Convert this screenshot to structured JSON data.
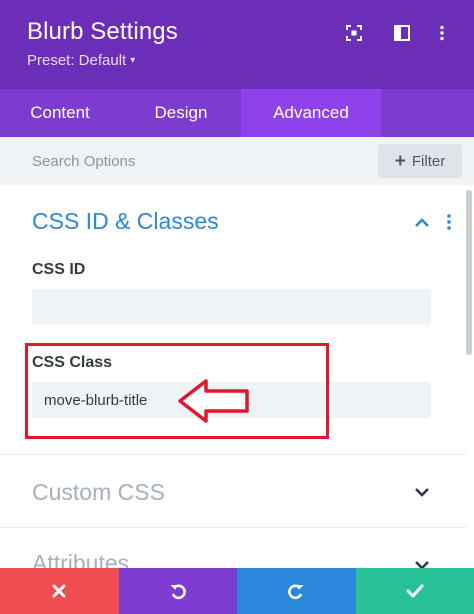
{
  "header": {
    "title": "Blurb Settings",
    "preset": "Preset: Default",
    "icons": [
      "fullscreen-icon",
      "split-view-icon",
      "more-options-icon"
    ],
    "background": "#6c2eb9"
  },
  "tabs": [
    {
      "label": "Content",
      "active": false
    },
    {
      "label": "Design",
      "active": false
    },
    {
      "label": "Advanced",
      "active": true
    }
  ],
  "search": {
    "placeholder": "Search Options",
    "filter_label": "Filter"
  },
  "sections": {
    "css_id_classes": {
      "title": "CSS ID & Classes",
      "expanded": true,
      "fields": {
        "css_id": {
          "label": "CSS ID",
          "value": ""
        },
        "css_class": {
          "label": "CSS Class",
          "value": "move-blurb-title"
        }
      }
    },
    "custom_css": {
      "title": "Custom CSS",
      "expanded": false
    },
    "attributes": {
      "title": "Attributes",
      "expanded": false
    }
  },
  "footer": {
    "buttons": [
      "discard-icon",
      "undo-icon",
      "redo-icon",
      "save-check-icon"
    ],
    "colors": {
      "discard": "#ef4d50",
      "undo": "#7e3bd0",
      "redo": "#2b87da",
      "save": "#28c197"
    }
  },
  "annotation_color": "#e0182b"
}
